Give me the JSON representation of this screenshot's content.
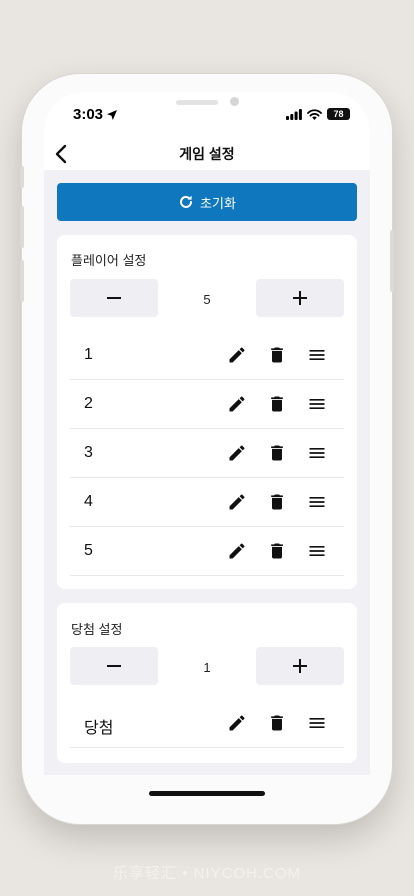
{
  "status_bar": {
    "time": "3:03",
    "battery": "78"
  },
  "header": {
    "title": "게임 설정"
  },
  "reset_button": {
    "label": "초기화"
  },
  "player_settings": {
    "title": "플레이어 설정",
    "count": "5",
    "items": [
      {
        "label": "1"
      },
      {
        "label": "2"
      },
      {
        "label": "3"
      },
      {
        "label": "4"
      },
      {
        "label": "5"
      }
    ]
  },
  "prize_settings": {
    "title": "당첨 설정",
    "count": "1",
    "items": [
      {
        "label": "당첨"
      }
    ]
  },
  "watermark": "乐享轻汇 • NIYCOH.COM",
  "colors": {
    "accent": "#0f77be",
    "background": "#f1f0f4"
  },
  "icons": {
    "row_actions": [
      "pencil-icon",
      "trash-icon",
      "menu-icon"
    ],
    "navigation": "chevron-left-icon",
    "reset": "refresh-icon"
  }
}
